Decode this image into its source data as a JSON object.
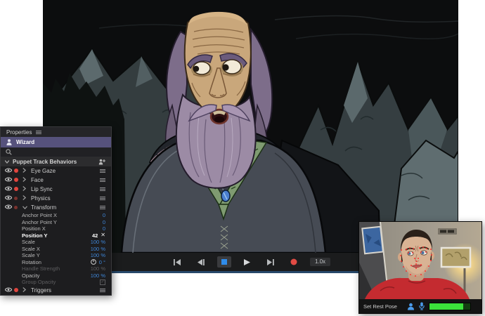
{
  "properties_panel": {
    "tab_label": "Properties",
    "puppet_name": "Wizard",
    "behaviors_header": "Puppet Track Behaviors",
    "behaviors": [
      {
        "label": "Eye Gaze",
        "armed": true
      },
      {
        "label": "Face",
        "armed": true
      },
      {
        "label": "Lip Sync",
        "armed": true
      },
      {
        "label": "Physics",
        "armed": false
      },
      {
        "label": "Transform",
        "armed": false,
        "expanded": true
      },
      {
        "label": "Triggers",
        "armed": true
      }
    ],
    "transform_properties": [
      {
        "label": "Anchor Point X",
        "value": "0"
      },
      {
        "label": "Anchor Point Y",
        "value": "0"
      },
      {
        "label": "Position X",
        "value": "0"
      },
      {
        "label": "Position Y",
        "value": "42"
      },
      {
        "label": "Scale",
        "value": "100 %"
      },
      {
        "label": "Scale X",
        "value": "100 %"
      },
      {
        "label": "Scale Y",
        "value": "100 %"
      },
      {
        "label": "Rotation",
        "value": "0 °"
      },
      {
        "label": "Handle Strength",
        "value": "100 %"
      },
      {
        "label": "Opacity",
        "value": "100 %"
      },
      {
        "label": "Group Opacity",
        "value": ""
      }
    ]
  },
  "playback": {
    "speed": "1.0x"
  },
  "camera_panel": {
    "set_rest_pose_label": "Set Rest Pose"
  },
  "colors": {
    "selection_purple": "#56527c",
    "value_blue": "#3f87d9",
    "armed_red": "#e0453e",
    "record_red": "#e14b44",
    "stop_blue": "#2f8ceb",
    "meter_green": "#3be23b"
  }
}
